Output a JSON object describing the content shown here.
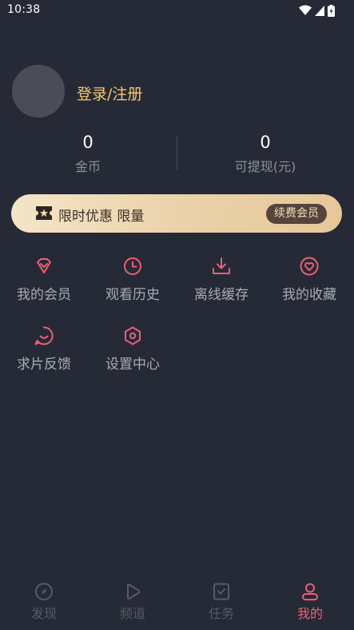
{
  "status_bar": {
    "time": "10:38"
  },
  "profile": {
    "login_label": "登录/注册"
  },
  "stats": [
    {
      "value": "0",
      "label": "金币"
    },
    {
      "value": "0",
      "label": "可提现(元)"
    }
  ],
  "vip_banner": {
    "text": "限时优惠 限量",
    "button_label": "续费会员"
  },
  "menu": [
    {
      "label": "我的会员",
      "icon": "diamond-icon"
    },
    {
      "label": "观看历史",
      "icon": "clock-icon"
    },
    {
      "label": "离线缓存",
      "icon": "download-icon"
    },
    {
      "label": "我的收藏",
      "icon": "heart-icon"
    },
    {
      "label": "求片反馈",
      "icon": "feedback-icon"
    },
    {
      "label": "设置中心",
      "icon": "settings-icon"
    }
  ],
  "bottom_nav": [
    {
      "label": "发现",
      "icon": "compass-icon",
      "active": false
    },
    {
      "label": "频道",
      "icon": "play-icon",
      "active": false
    },
    {
      "label": "任务",
      "icon": "task-icon",
      "active": false
    },
    {
      "label": "我的",
      "icon": "user-icon",
      "active": true
    }
  ],
  "colors": {
    "background": "#262a37",
    "accent": "#ec5f72",
    "gold": "#f6c76e",
    "muted_text": "#a7abb6",
    "inactive_nav": "#575b67"
  }
}
